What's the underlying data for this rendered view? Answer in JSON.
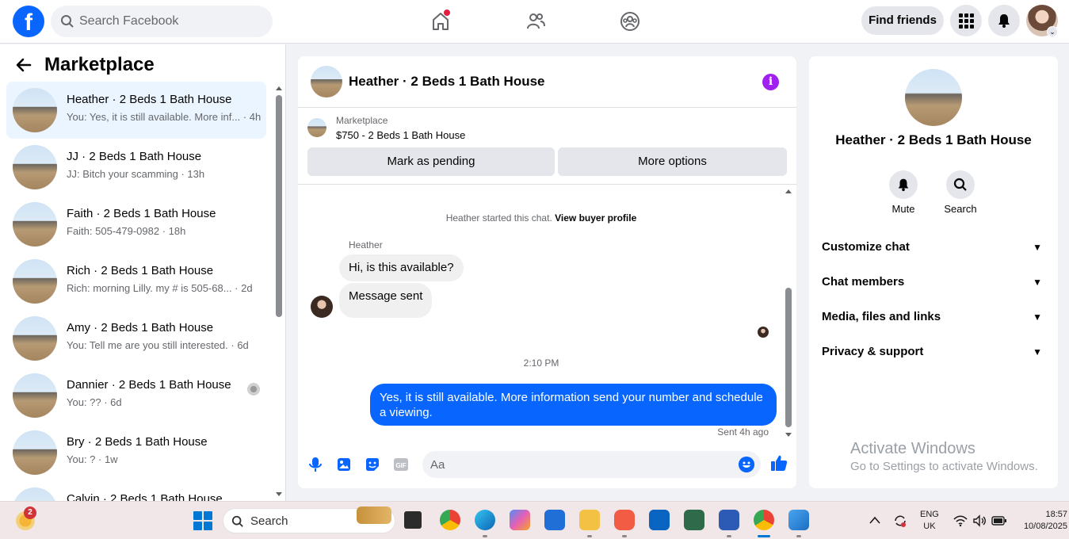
{
  "topbar": {
    "search_placeholder": "Search Facebook",
    "find_friends": "Find friends"
  },
  "sidebar": {
    "title": "Marketplace",
    "conversations": [
      {
        "name": "Heather · 2 Beds 1 Bath House",
        "preview": "You: Yes, it is still available. More inf... · 4h",
        "active": true
      },
      {
        "name": "JJ · 2 Beds 1 Bath House",
        "preview": "JJ: Bitch your scamming · 13h"
      },
      {
        "name": "Faith · 2 Beds 1 Bath House",
        "preview": "Faith: 505-479-0982 · 18h"
      },
      {
        "name": "Rich · 2 Beds 1 Bath House",
        "preview": "Rich: morning Lilly. my # is 505-68...  · 2d"
      },
      {
        "name": "Amy · 2 Beds 1 Bath House",
        "preview": "You: Tell me are you still interested. · 6d"
      },
      {
        "name": "Dannier · 2 Beds 1 Bath House",
        "preview": "You: ?? · 6d"
      },
      {
        "name": "Bry · 2 Beds 1 Bath House",
        "preview": "You: ? · 1w"
      },
      {
        "name": "Calvin · 2 Beds 1 Bath House",
        "preview": ""
      }
    ]
  },
  "chat": {
    "title": "Heather · 2 Beds 1 Bath House",
    "listing_category": "Marketplace",
    "listing_price": "$750 - 2 Beds 1 Bath House",
    "mark_pending": "Mark as pending",
    "more_options": "More options",
    "system_text": "Heather started this chat.",
    "system_link": "View buyer profile",
    "sender_name": "Heather",
    "messages_in": [
      "Hi, is this available?",
      "Message sent"
    ],
    "time_separator": "2:10 PM",
    "message_out": "Yes, it is still available. More information send your number and schedule a viewing.",
    "sent_status": "Sent 4h ago",
    "composer_placeholder": "Aa"
  },
  "details": {
    "name": "Heather · 2 Beds 1 Bath House",
    "mute": "Mute",
    "search": "Search",
    "sections": [
      "Customize chat",
      "Chat members",
      "Media, files and links",
      "Privacy & support"
    ]
  },
  "watermark": {
    "line1": "Activate Windows",
    "line2": "Go to Settings to activate Windows."
  },
  "taskbar": {
    "weather_badge": "2",
    "search_placeholder": "Search",
    "lang_1": "ENG",
    "lang_2": "UK",
    "time": "18:57",
    "date": "10/08/2025"
  },
  "colors": {
    "brand": "#0866ff",
    "info_accent": "#a020f0",
    "active_conversation": "#ebf5ff"
  }
}
